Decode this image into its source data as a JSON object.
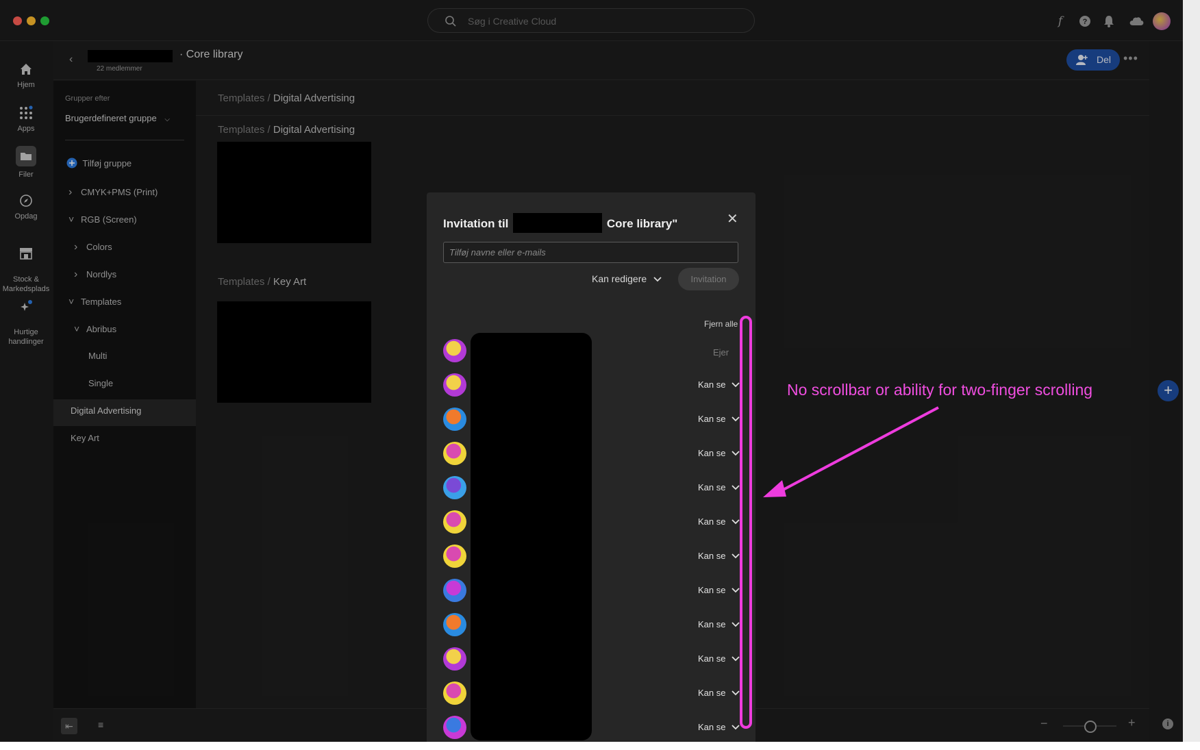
{
  "search": {
    "placeholder": "Søg i Creative Cloud"
  },
  "rail": {
    "items": [
      {
        "label": "Hjem",
        "icon": "home-icon"
      },
      {
        "label": "Apps",
        "icon": "apps-grid-icon"
      },
      {
        "label": "Filer",
        "icon": "folder-icon",
        "selected": true
      },
      {
        "label": "Opdag",
        "icon": "discover-icon"
      },
      {
        "label": "Stock &\nMarkedsplads",
        "icon": "stock-icon"
      },
      {
        "label": "Hurtige\nhandlinger",
        "icon": "quick-actions-icon"
      }
    ]
  },
  "header": {
    "title": "· Core library",
    "members": "22 medlemmer",
    "share_label": "Del"
  },
  "groups": {
    "label": "Grupper efter",
    "dropdown": "Brugerdefineret gruppe",
    "add": "Tilføj gruppe",
    "items": [
      {
        "label": "CMYK+PMS (Print)",
        "chevron": "right",
        "indent": 0
      },
      {
        "label": "RGB (Screen)",
        "chevron": "down",
        "indent": 0
      },
      {
        "label": "Colors",
        "chevron": "right",
        "indent": 1
      },
      {
        "label": "Nordlys",
        "chevron": "right",
        "indent": 1
      },
      {
        "label": "Templates",
        "chevron": "down",
        "indent": 0
      },
      {
        "label": "Abribus",
        "chevron": "down",
        "indent": 1
      },
      {
        "label": "Multi",
        "chevron": "",
        "indent": 2
      },
      {
        "label": "Single",
        "chevron": "",
        "indent": 2
      },
      {
        "label": "Digital Advertising",
        "chevron": "",
        "indent": 1,
        "selected": true
      },
      {
        "label": "Key Art",
        "chevron": "",
        "indent": 1
      }
    ]
  },
  "content": {
    "breadcrumb_top": {
      "parent": "Templates /",
      "current": "Digital Advertising"
    },
    "sections": [
      {
        "parent": "Templates /",
        "current": "Digital Advertising"
      },
      {
        "parent": "Templates /",
        "current": "Key Art"
      }
    ]
  },
  "modal": {
    "title_prefix": "Invitation til",
    "title_suffix": "Core library\"",
    "input_placeholder": "Tilføj navne eller e-mails",
    "permission": "Kan redigere",
    "invite_button": "Invitation",
    "remove_all": "Fjern alle",
    "owner": "Ejer",
    "members": [
      {
        "role": "Kan se",
        "avatar_colors": [
          "#b23ad6",
          "#f2d14a"
        ]
      },
      {
        "role": "Kan se",
        "avatar_colors": [
          "#2a8be0",
          "#f07a2c"
        ]
      },
      {
        "role": "Kan se",
        "avatar_colors": [
          "#f0d43a",
          "#d94ab0"
        ]
      },
      {
        "role": "Kan se",
        "avatar_colors": [
          "#3aa0e8",
          "#7a4ad6"
        ]
      },
      {
        "role": "Kan se",
        "avatar_colors": [
          "#f0d43a",
          "#d94ab0"
        ]
      },
      {
        "role": "Kan se",
        "avatar_colors": [
          "#f0d43a",
          "#d94ab0"
        ]
      },
      {
        "role": "Kan se",
        "avatar_colors": [
          "#3a7ae0",
          "#c83ad6"
        ]
      },
      {
        "role": "Kan se",
        "avatar_colors": [
          "#2a8be0",
          "#f07a2c"
        ]
      },
      {
        "role": "Kan se",
        "avatar_colors": [
          "#b23ad6",
          "#f2d14a"
        ]
      },
      {
        "role": "Kan se",
        "avatar_colors": [
          "#f0d43a",
          "#d94ab0"
        ]
      },
      {
        "role": "Kan se",
        "avatar_colors": [
          "#c83ad6",
          "#3a7ae0"
        ]
      },
      {
        "role": "Kan se",
        "avatar_colors": [
          "#c83ad6",
          "#3a7ae0"
        ]
      }
    ]
  },
  "annotation": {
    "text": "No scrollbar or ability for two-finger scrolling",
    "color": "#f04ee0"
  }
}
